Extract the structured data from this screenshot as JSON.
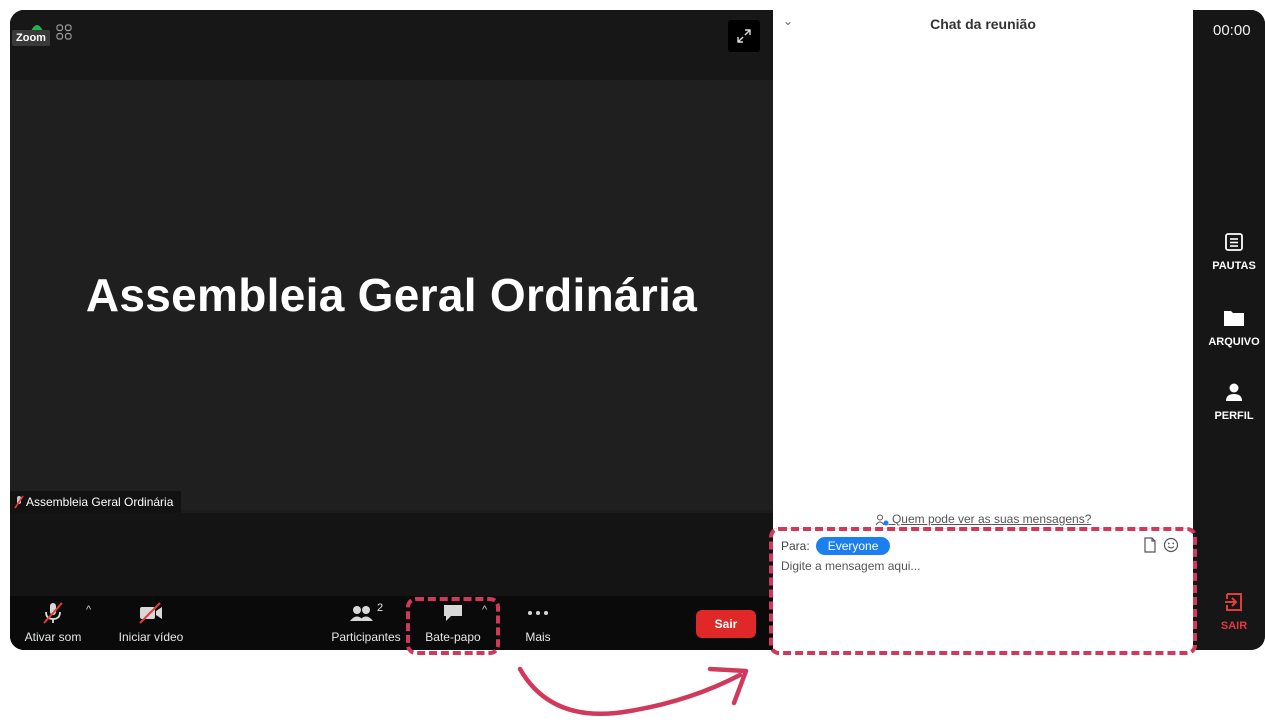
{
  "app": {
    "badge": "Zoom"
  },
  "meeting": {
    "title": "Assembleia Geral Ordinária",
    "name_tag": "Assembleia Geral Ordinária"
  },
  "controls": {
    "mute_label": "Ativar som",
    "video_label": "Iniciar vídeo",
    "participants_label": "Participantes",
    "participants_count": "2",
    "chat_label": "Bate-papo",
    "more_label": "Mais",
    "leave_label": "Sair"
  },
  "chat": {
    "title": "Chat da reunião",
    "who_sees": "Quem pode ver as suas mensagens?",
    "to_label": "Para:",
    "recipient": "Everyone",
    "input_placeholder": "Digite a mensagem aqui..."
  },
  "sidebar": {
    "timer": "00:00",
    "items": [
      {
        "label": "PAUTAS",
        "icon": "list-icon"
      },
      {
        "label": "ARQUIVO",
        "icon": "folder-icon"
      },
      {
        "label": "PERFIL",
        "icon": "user-icon"
      },
      {
        "label": "SAIR",
        "icon": "exit-icon"
      }
    ]
  },
  "colors": {
    "accent_blue": "#1b7ff0",
    "leave_red": "#e02828",
    "highlight": "#d0395c",
    "exit_red": "#e23b3b"
  }
}
